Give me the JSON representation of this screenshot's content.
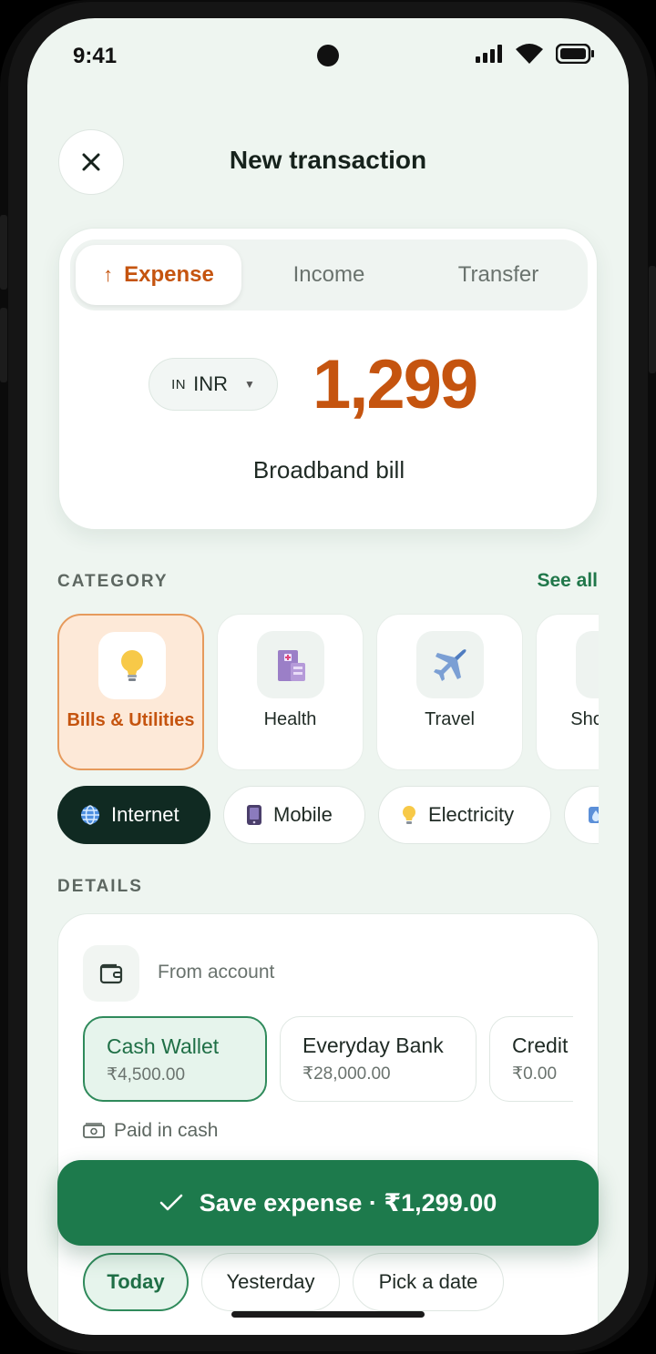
{
  "status_bar": {
    "time": "9:41"
  },
  "header": {
    "title": "New transaction"
  },
  "type_tabs": [
    {
      "label": "Expense",
      "active": true
    },
    {
      "label": "Income",
      "active": false
    },
    {
      "label": "Transfer",
      "active": false
    }
  ],
  "amount": {
    "currency_flag_code": "IN",
    "currency": "INR",
    "value": "1,299",
    "note": "Broadband bill"
  },
  "category": {
    "label": "CATEGORY",
    "see_all": "See all",
    "items": [
      {
        "label": "Bills & Utilities",
        "icon": "lightbulb-icon",
        "active": true
      },
      {
        "label": "Health",
        "icon": "hospital-icon",
        "active": false
      },
      {
        "label": "Travel",
        "icon": "airplane-icon",
        "active": false
      },
      {
        "label": "Shopping",
        "icon": "shopping-icon",
        "active": false
      }
    ]
  },
  "subcategories": [
    {
      "label": "Internet",
      "icon": "globe-icon",
      "active": true
    },
    {
      "label": "Mobile",
      "icon": "mobile-phone-icon",
      "active": false
    },
    {
      "label": "Electricity",
      "icon": "lightbulb-icon",
      "active": false
    },
    {
      "label": "",
      "icon": "water-icon",
      "active": false
    }
  ],
  "details": {
    "label": "DETAILS",
    "from_account_label": "From account",
    "accounts": [
      {
        "name": "Cash Wallet",
        "balance": "₹4,500.00",
        "active": true
      },
      {
        "name": "Everyday Bank",
        "balance": "₹28,000.00",
        "active": false
      },
      {
        "name": "Credit",
        "balance": "₹0.00",
        "active": false
      }
    ],
    "payment_note": "Paid in cash",
    "dates": [
      {
        "label": "Today",
        "active": true
      },
      {
        "label": "Yesterday",
        "active": false
      },
      {
        "label": "Pick a date",
        "active": false
      }
    ]
  },
  "save_button": {
    "label": "Save expense · ₹1,299.00"
  },
  "colors": {
    "accent_expense": "#c5540f",
    "primary_green": "#1d7a4c",
    "background": "#eef5f0"
  }
}
